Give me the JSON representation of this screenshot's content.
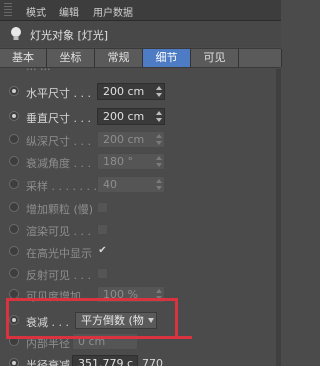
{
  "menubar": {
    "items": [
      "模式",
      "编辑",
      "用户数据"
    ]
  },
  "panel": {
    "title": "灯光对象 [灯光]"
  },
  "tabs": [
    {
      "label": "基本"
    },
    {
      "label": "坐标"
    },
    {
      "label": "常规"
    },
    {
      "label": "细节",
      "active": true
    },
    {
      "label": "可见"
    },
    {
      "label": ""
    }
  ],
  "rows": {
    "partial_top": {
      "label": "... ..."
    },
    "horizontal_size": {
      "label": "水平尺寸 . . .",
      "value": "200 cm"
    },
    "vertical_size": {
      "label": "垂直尺寸 . . .",
      "value": "200 cm"
    },
    "depth_size": {
      "label": "纵深尺寸 . . .",
      "value": "200 cm"
    },
    "falloff_angle": {
      "label": "衰减角度 . . .",
      "value": "180 °"
    },
    "samples": {
      "label": "采样 . . . . . . .",
      "value": "40"
    },
    "add_grain": {
      "label": "增加颗粒 (慢)"
    },
    "render_visible": {
      "label": "渲染可见 . . ."
    },
    "show_in_highlight": {
      "label": "在高光中显示",
      "mark": "✔"
    },
    "reflection_visible": {
      "label": "反射可见 . . ."
    },
    "visibility_increase": {
      "label": "可见度增加 . .",
      "value": "100 %"
    },
    "falloff": {
      "label": "衰减 . . .",
      "value": "平方倒数 (物"
    },
    "inner_radius": {
      "label": "内部半径 .",
      "value": "0 cm"
    },
    "radius_falloff": {
      "label": "半径衰减 .",
      "value": "351.779 c",
      "extra": "770"
    }
  },
  "colors": {
    "accent_tab": "#4e7cc4",
    "highlight_box": "#d8333e"
  }
}
